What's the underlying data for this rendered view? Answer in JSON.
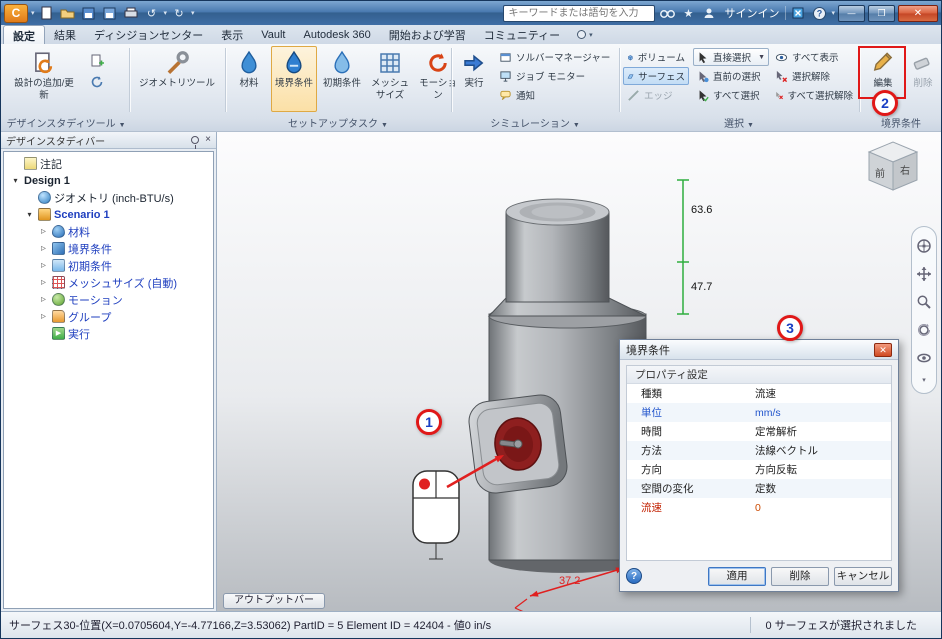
{
  "colors": {
    "titlebar_blue": "#3f6ea5",
    "ribbon_bg": "#e2e8f0",
    "selected_orange": "#fbe0a6",
    "selection_blue": "#c3ddf5",
    "link_blue": "#1f3fbf",
    "callout_red": "#e01818",
    "callout_number_blue": "#1a3fc4",
    "dimension_green": "#2fae3f",
    "dimension_red": "#e02020",
    "value_orange": "#cc4a00"
  },
  "titlebar": {
    "search_placeholder": "キーワードまたは語句を入力",
    "signin_label": "サインイン"
  },
  "tabs": [
    "設定",
    "結果",
    "ディシジョンセンター",
    "表示",
    "Vault",
    "Autodesk 360",
    "開始および学習",
    "コミュニティー"
  ],
  "ribbon": {
    "design_tools": {
      "add_update": "設計の追加/更新",
      "geometry_tools": "ジオメトリツール",
      "group_label": "デザインスタディツール"
    },
    "setup": {
      "materials": "材料",
      "boundary": "境界条件",
      "initial": "初期条件",
      "mesh_size": "メッシュサイズ",
      "motion": "モーション",
      "group_label": "セットアップタスク"
    },
    "simulation": {
      "solve": "実行",
      "solver_manager": "ソルバーマネージャー",
      "job_monitor": "ジョブ モニター",
      "notification": "通知",
      "group_label": "シミュレーション"
    },
    "selection": {
      "volume": "ボリューム",
      "surface": "サーフェス",
      "edge": "エッジ",
      "direct": "直接選択",
      "previous": "直前の選択",
      "select_all": "すべて選択",
      "show_all": "すべて表示",
      "deselect": "選択解除",
      "deselect_all": "すべて選択解除",
      "group_label": "選択"
    },
    "bc_group": {
      "edit": "編集",
      "delete": "削除",
      "group_label": "境界条件"
    }
  },
  "study_bar": {
    "title": "デザインスタディバー",
    "items": [
      {
        "label": "注記"
      },
      {
        "label": "Design 1"
      },
      {
        "label": "ジオメトリ (inch-BTU/s)"
      },
      {
        "label": "Scenario 1"
      },
      {
        "label": "材料"
      },
      {
        "label": "境界条件"
      },
      {
        "label": "初期条件"
      },
      {
        "label": "メッシュサイズ (自動)"
      },
      {
        "label": "モーション"
      },
      {
        "label": "グループ"
      },
      {
        "label": "実行"
      }
    ]
  },
  "viewport": {
    "output_bar_label": "アウトプットバー",
    "dimensions": {
      "height_top": "63.6",
      "height_mid": "47.7",
      "width_bottom": "37.2"
    },
    "viewcube": {
      "front": "前",
      "right": "右"
    },
    "callouts": {
      "one": "1",
      "two": "2",
      "three": "3"
    }
  },
  "dialog": {
    "title": "境界条件",
    "section_title": "プロパティ設定",
    "rows": [
      {
        "label": "種類",
        "value": "流速"
      },
      {
        "label": "単位",
        "value": "mm/s"
      },
      {
        "label": "時間",
        "value": "定常解析"
      },
      {
        "label": "方法",
        "value": "法線ベクトル"
      },
      {
        "label": "方向",
        "value": "方向反転"
      },
      {
        "label": "空間の変化",
        "value": "定数"
      },
      {
        "label": "流速",
        "value": "0"
      }
    ],
    "buttons": {
      "apply": "適用",
      "delete": "削除",
      "cancel": "キャンセル"
    }
  },
  "statusbar": {
    "left": "サーフェス30-位置(X=0.0705604,Y=-4.77166,Z=3.53062) PartID = 5 Element ID = 42404 - 値0  in/s",
    "right": "0 サーフェスが選択されました"
  }
}
